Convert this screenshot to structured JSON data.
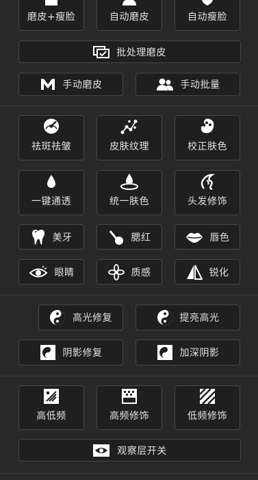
{
  "top_row": [
    {
      "label": "磨皮+瘦脸",
      "icon": "face-icon"
    },
    {
      "label": "自动磨皮",
      "icon": "person-icon"
    },
    {
      "label": "自动瘦脸",
      "icon": "mask-icon"
    }
  ],
  "batch_smooth": {
    "label": "批处理磨皮",
    "icon": "batch-icon"
  },
  "manual": [
    {
      "label": "手动磨皮",
      "icon": "m-logo-icon"
    },
    {
      "label": "手动批量",
      "icon": "users-icon"
    }
  ],
  "skin_tools": [
    {
      "label": "祛斑祛皱",
      "icon": "gauge-icon"
    },
    {
      "label": "皮肤纹理",
      "icon": "nodes-icon"
    },
    {
      "label": "校正肤色",
      "icon": "palette-icon"
    },
    {
      "label": "一键通透",
      "icon": "drop-icon"
    },
    {
      "label": "统一肤色",
      "icon": "drop-ripple-icon"
    },
    {
      "label": "头发修饰",
      "icon": "hair-icon"
    }
  ],
  "small_tools": [
    {
      "label": "美牙",
      "icon": "tooth-icon"
    },
    {
      "label": "腮红",
      "icon": "brush-icon"
    },
    {
      "label": "唇色",
      "icon": "lips-icon"
    },
    {
      "label": "眼睛",
      "icon": "eye-icon"
    },
    {
      "label": "质感",
      "icon": "flower-icon"
    },
    {
      "label": "锐化",
      "icon": "sharpen-icon"
    }
  ],
  "light_tools": [
    {
      "label": "高光修复",
      "icon": "yin-yang-icon"
    },
    {
      "label": "提亮高光",
      "icon": "yin-yang-icon"
    },
    {
      "label": "阴影修复",
      "icon": "shadow-icon"
    },
    {
      "label": "加深阴影",
      "icon": "shadow-icon"
    }
  ],
  "frequency_tools": [
    {
      "label": "高低频",
      "icon": "freq-icon"
    },
    {
      "label": "高频修饰",
      "icon": "grid-icon"
    },
    {
      "label": "低频修饰",
      "icon": "stripes-icon"
    }
  ],
  "observer": {
    "label": "观察层开关",
    "icon": "observer-eye-icon"
  }
}
